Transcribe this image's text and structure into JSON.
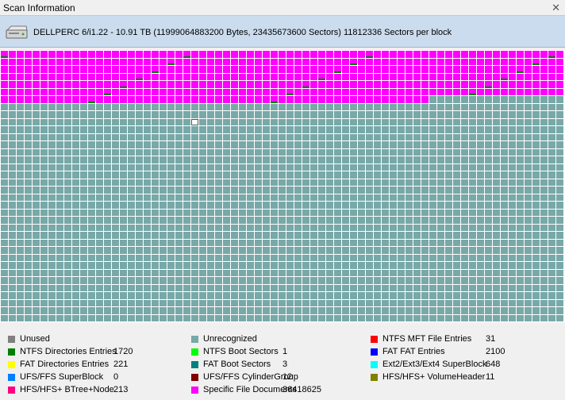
{
  "window": {
    "title": "Scan Information",
    "close_glyph": "✕"
  },
  "header": {
    "icon": "hard-disk-icon",
    "text": "DELLPERC 6/i1.22 - 10.91 TB (11999064883200 Bytes, 23435673600 Sectors) 11812336 Sectors per block"
  },
  "block_map": {
    "cell_colors": {
      "specific": "#ff00ff",
      "unrecognized": "#78a8a8",
      "ntfs_dir": "#007800",
      "grid": "#ffffff"
    },
    "specific_cells": 480,
    "total_cells": 2556,
    "selected_cell_index": 663
  },
  "legend": {
    "items": [
      {
        "label": "Unused",
        "count": "",
        "color": "#808080"
      },
      {
        "label": "Unrecognized",
        "count": "",
        "color": "#78a8a8"
      },
      {
        "label": "NTFS MFT File Entries",
        "count": "31",
        "color": "#ff0000"
      },
      {
        "label": "NTFS Directories Entries",
        "count": "1720",
        "color": "#008000"
      },
      {
        "label": "NTFS Boot Sectors",
        "count": "1",
        "color": "#00ff00"
      },
      {
        "label": "FAT FAT Entries",
        "count": "2100",
        "color": "#0000ff"
      },
      {
        "label": "FAT Directories Entries",
        "count": "221",
        "color": "#ffff00"
      },
      {
        "label": "FAT Boot Sectors",
        "count": "3",
        "color": "#008080"
      },
      {
        "label": "Ext2/Ext3/Ext4 SuperBlock",
        "count": "648",
        "color": "#00ffff"
      },
      {
        "label": "UFS/FFS SuperBlock",
        "count": "0",
        "color": "#0080ff"
      },
      {
        "label": "UFS/FFS CylinderGroup",
        "count": "12",
        "color": "#800000"
      },
      {
        "label": "HFS/HFS+ VolumeHeader",
        "count": "11",
        "color": "#808000"
      },
      {
        "label": "HFS/HFS+ BTree+Node",
        "count": "213",
        "color": "#ff0080"
      },
      {
        "label": "Specific File Documents",
        "count": "36418625",
        "color": "#ff00ff"
      }
    ]
  }
}
